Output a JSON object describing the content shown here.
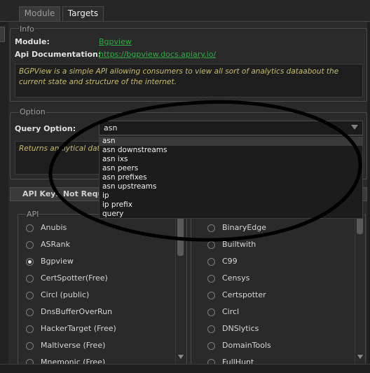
{
  "tabs": [
    {
      "label": "Module",
      "active": false
    },
    {
      "label": "Targets",
      "active": true
    }
  ],
  "info": {
    "group_title": "Info",
    "module_label": "Module:",
    "module_value": "Bgpview",
    "api_doc_label": "Api Documentation:",
    "api_doc_value": "https://bgpview.docs.apiary.io/",
    "description": "BGPView is a simple API allowing consumers to view all sort of analytics dataabout the current state and structure of the internet."
  },
  "option": {
    "group_title": "Option",
    "query_label": "Query Option:",
    "selected": "asn",
    "description_partial": "Returns analytical data",
    "dropdown_items": [
      "asn",
      "asn downstreams",
      "asn ixs",
      "asn peers",
      "asn prefixes",
      "asn upstreams",
      "ip",
      "ip prefix",
      "query"
    ]
  },
  "api_panel": {
    "header": "API Keys Not Required",
    "group_title": "API",
    "left_items": [
      {
        "label": "Anubis",
        "checked": false
      },
      {
        "label": "ASRank",
        "checked": false
      },
      {
        "label": "Bgpview",
        "checked": true
      },
      {
        "label": "CertSpotter(Free)",
        "checked": false
      },
      {
        "label": "Circl (public)",
        "checked": false
      },
      {
        "label": "DnsBufferOverRun",
        "checked": false
      },
      {
        "label": "HackerTarget (Free)",
        "checked": false
      },
      {
        "label": "Maltiverse (Free)",
        "checked": false
      },
      {
        "label": "Mnemonic (Free)",
        "checked": false
      }
    ],
    "right_items": [
      {
        "label": "BinaryEdge",
        "checked": false
      },
      {
        "label": "Builtwith",
        "checked": false
      },
      {
        "label": "C99",
        "checked": false
      },
      {
        "label": "Censys",
        "checked": false
      },
      {
        "label": "Certspotter",
        "checked": false
      },
      {
        "label": "Circl",
        "checked": false
      },
      {
        "label": "DNSlytics",
        "checked": false
      },
      {
        "label": "DomainTools",
        "checked": false
      },
      {
        "label": "FullHunt",
        "checked": false
      }
    ]
  },
  "annotation": {
    "shape": "hand-drawn-ellipse",
    "color": "#000000"
  },
  "colors": {
    "background": "#2a2a2a",
    "link": "#2faa46",
    "description_text": "#c8bb6d"
  }
}
